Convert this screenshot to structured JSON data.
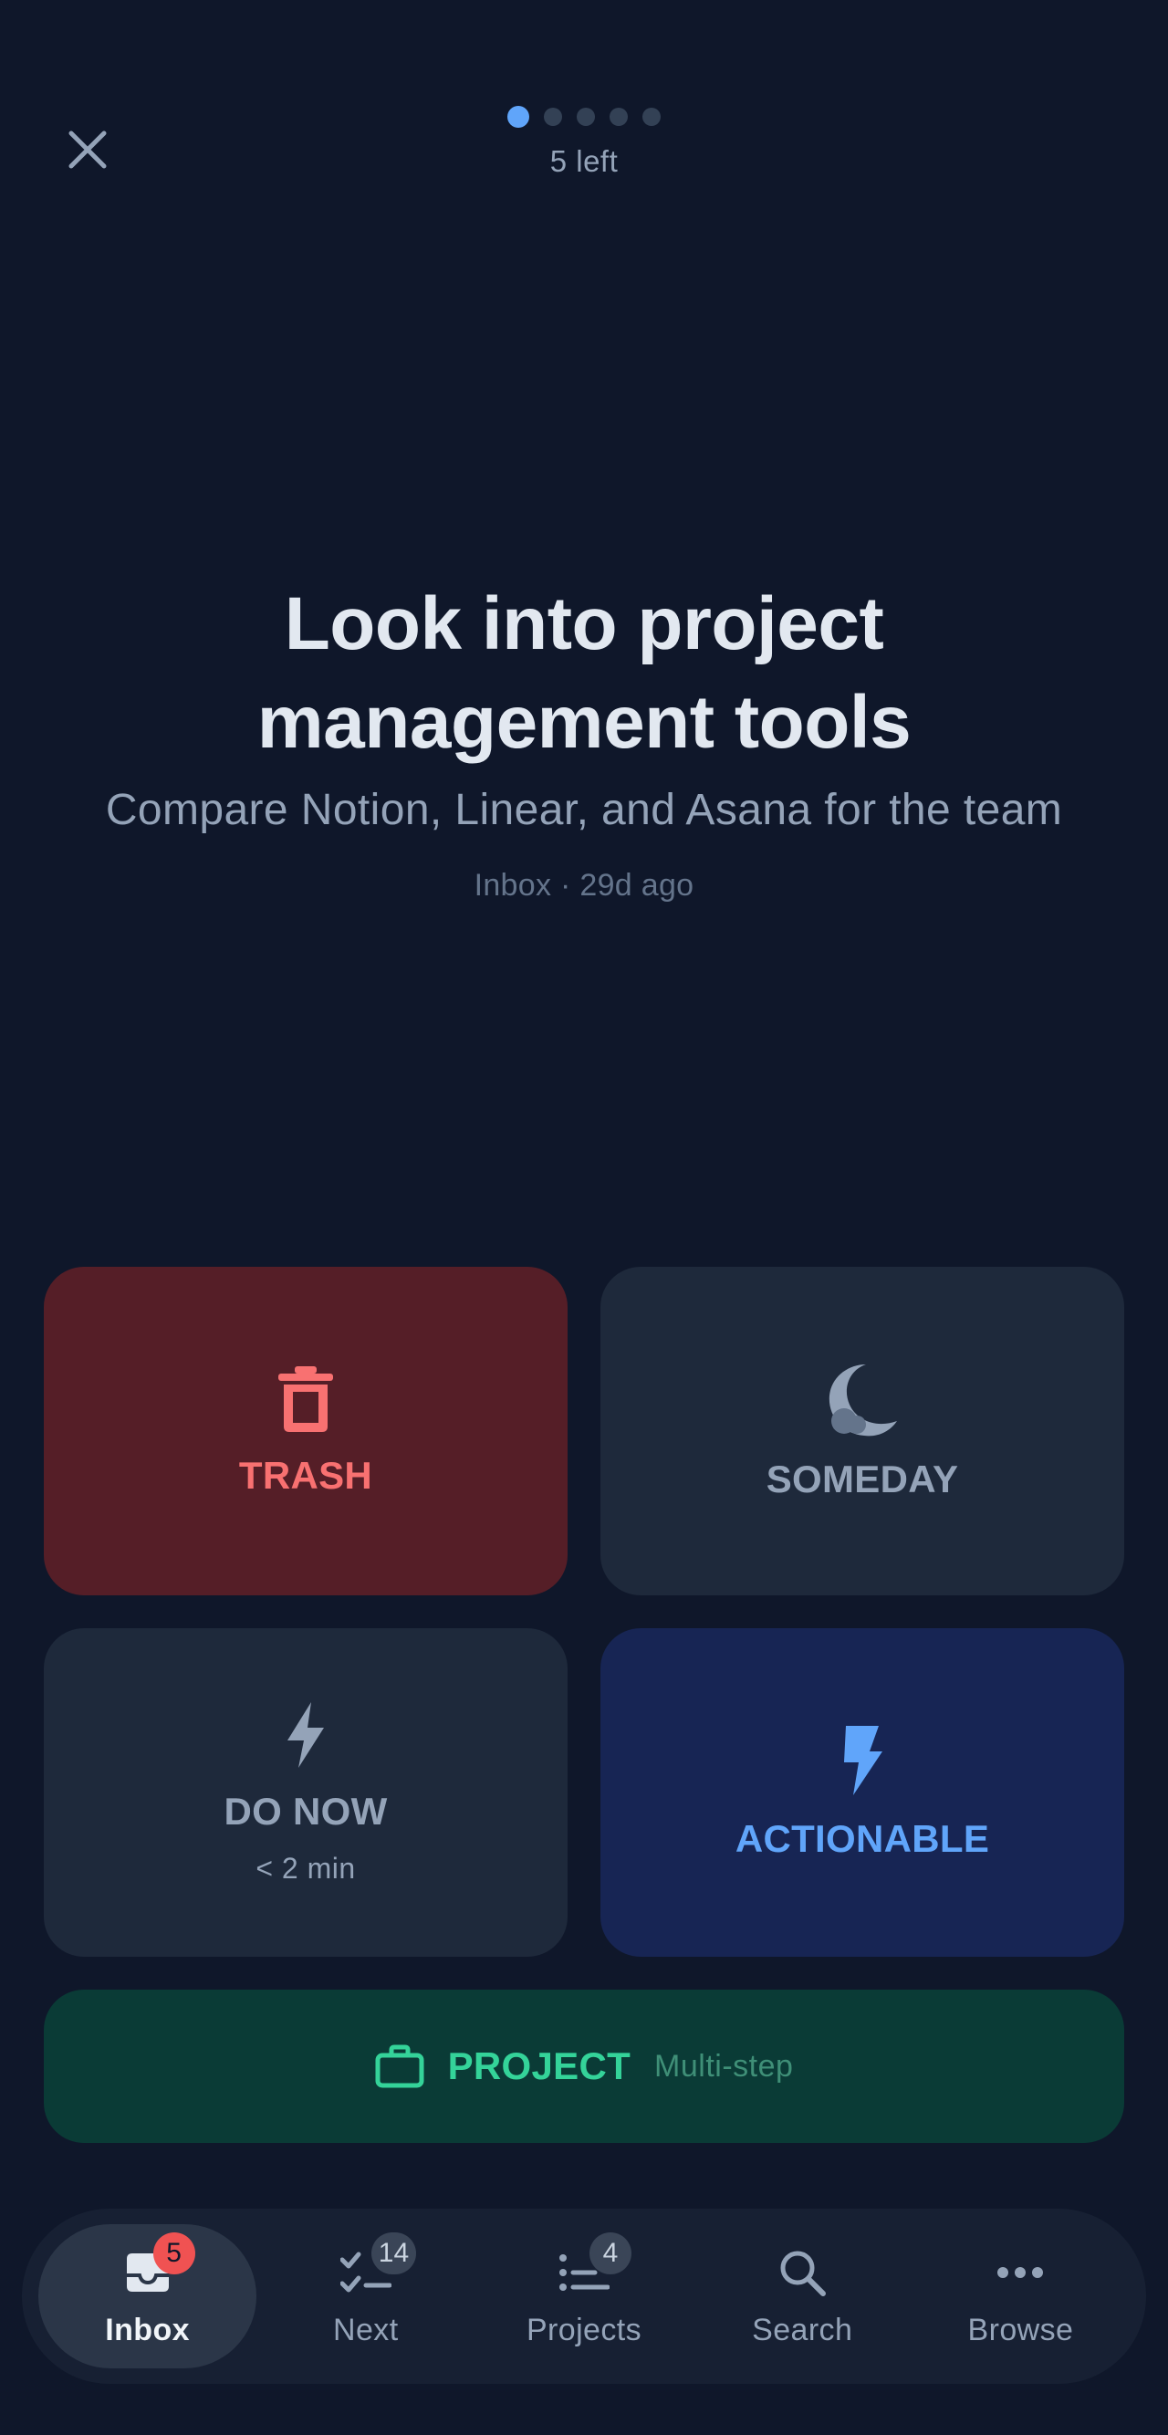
{
  "progress": {
    "left_label": "5 left",
    "total": 5,
    "current": 1
  },
  "item": {
    "title": "Look into project management tools",
    "description": "Compare Notion, Linear, and Asana for the team",
    "meta": "Inbox · 29d ago"
  },
  "actions": {
    "trash": {
      "label": "TRASH",
      "icon": "trash-icon",
      "color": "#f87171"
    },
    "someday": {
      "label": "SOMEDAY",
      "icon": "moon-icon",
      "color": "#94a3b8"
    },
    "do_now": {
      "label": "DO NOW",
      "sub": "< 2 min",
      "icon": "lightning-icon",
      "color": "#94a3b8"
    },
    "actionable": {
      "label": "ACTIONABLE",
      "icon": "lightning-filled-icon",
      "color": "#60a5fa"
    },
    "project": {
      "label": "PROJECT",
      "sub": "Multi-step",
      "icon": "briefcase-icon",
      "color": "#34d399"
    }
  },
  "nav": {
    "inbox": {
      "label": "Inbox",
      "badge": "5",
      "icon": "inbox-icon"
    },
    "next": {
      "label": "Next",
      "badge": "14",
      "icon": "checklist-icon"
    },
    "projects": {
      "label": "Projects",
      "badge": "4",
      "icon": "list-icon"
    },
    "search": {
      "label": "Search",
      "icon": "search-icon"
    },
    "browse": {
      "label": "Browse",
      "icon": "more-icon"
    }
  }
}
